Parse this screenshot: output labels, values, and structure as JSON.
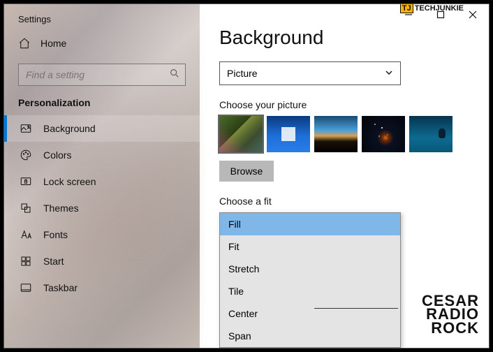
{
  "app_title": "Settings",
  "home_label": "Home",
  "search_placeholder": "Find a setting",
  "section_label": "Personalization",
  "nav": [
    {
      "label": "Background"
    },
    {
      "label": "Colors"
    },
    {
      "label": "Lock screen"
    },
    {
      "label": "Themes"
    },
    {
      "label": "Fonts"
    },
    {
      "label": "Start"
    },
    {
      "label": "Taskbar"
    }
  ],
  "page_heading": "Background",
  "bg_dropdown_value": "Picture",
  "picture_label": "Choose your picture",
  "browse_label": "Browse",
  "fit_label": "Choose a fit",
  "fit_options": [
    "Fill",
    "Fit",
    "Stretch",
    "Tile",
    "Center",
    "Span"
  ],
  "fit_selected": "Fill",
  "watermark_top": "TECHJUNKIE",
  "watermark_bottom": [
    "CESAR",
    "RADIO",
    "ROCK"
  ]
}
